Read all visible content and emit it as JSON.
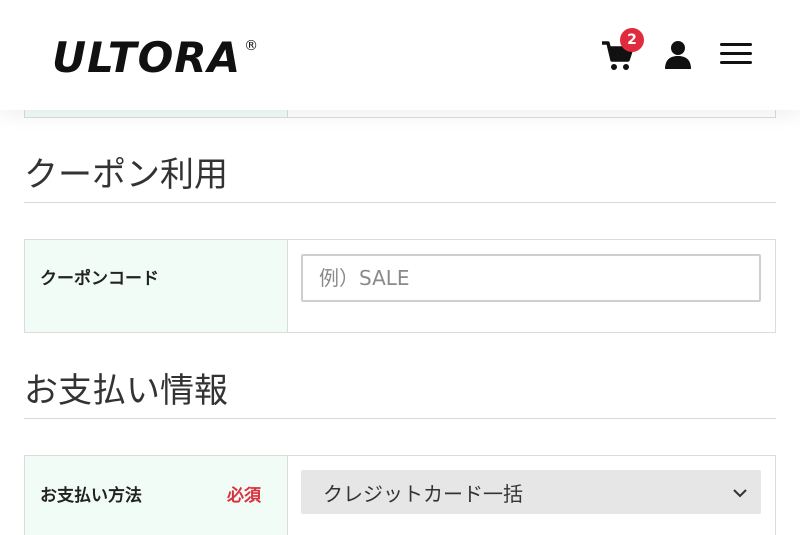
{
  "header": {
    "logo_text": "ULTORA",
    "logo_mark": "®",
    "cart_badge": "2",
    "icons": [
      "cart-icon",
      "user-icon",
      "hamburger-menu-icon"
    ]
  },
  "coupon_section": {
    "title": "クーポン利用",
    "label": "クーポンコード",
    "input_value": "",
    "input_placeholder": "例）SALE"
  },
  "payment_section": {
    "title": "お支払い情報",
    "label": "お支払い方法",
    "required_label": "必須",
    "selected_option": "クレジットカード一括"
  },
  "colors": {
    "badge": "#e02b3f",
    "required": "#d8323c",
    "label_cell_bg": "#f2fcf7",
    "select_bg": "#e6e6e6"
  }
}
